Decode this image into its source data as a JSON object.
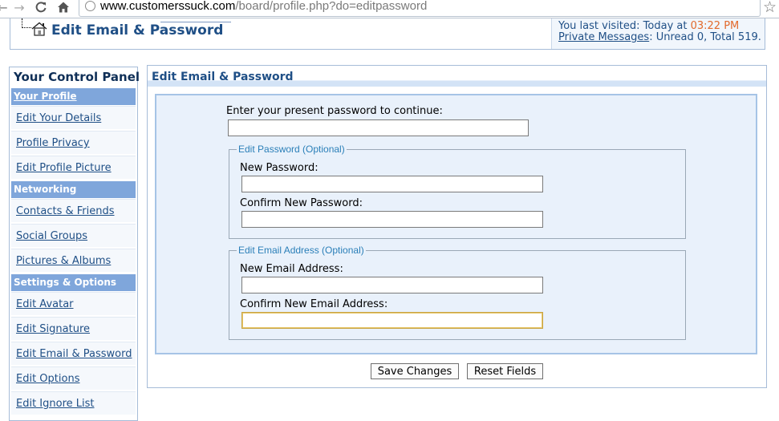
{
  "browser": {
    "url_domain": "www.customerssuck.com",
    "url_path": "/board/profile.php?do=editpassword"
  },
  "header": {
    "title": "Edit Email & Password",
    "last_visited_label": "You last visited: Today at ",
    "last_visited_time": "03:22 PM",
    "private_messages_link": "Private Messages",
    "private_messages_info": ": Unread 0, Total 519."
  },
  "sidebar": {
    "title": "Your Control Panel",
    "sections": [
      {
        "label": "Your Profile",
        "items": [
          "Edit Your Details",
          "Profile Privacy",
          "Edit Profile Picture"
        ]
      },
      {
        "label": "Networking",
        "items": [
          "Contacts & Friends",
          "Social Groups",
          "Pictures & Albums"
        ]
      },
      {
        "label": "Settings & Options",
        "items": [
          "Edit Avatar",
          "Edit Signature",
          "Edit Email & Password",
          "Edit Options",
          "Edit Ignore List"
        ]
      }
    ]
  },
  "main": {
    "title": "Edit Email & Password",
    "present_password_label": "Enter your present password to continue:",
    "present_password_value": "",
    "password_group": {
      "legend": "Edit Password (Optional)",
      "new_label": "New Password:",
      "new_value": "",
      "confirm_label": "Confirm New Password:",
      "confirm_value": ""
    },
    "email_group": {
      "legend": "Edit Email Address (Optional)",
      "new_label": "New Email Address:",
      "new_value": "",
      "confirm_label": "Confirm New Email Address:",
      "confirm_value": ""
    },
    "save_button": "Save Changes",
    "reset_button": "Reset Fields"
  }
}
